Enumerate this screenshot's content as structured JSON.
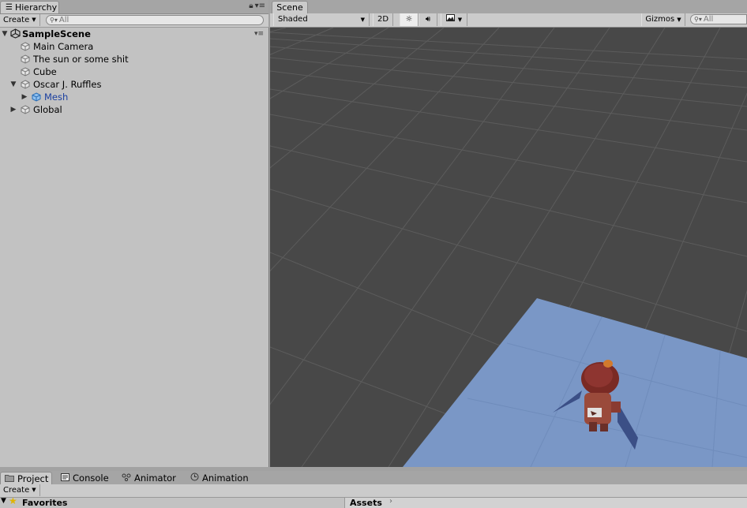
{
  "hierarchy": {
    "tab_label": "Hierarchy",
    "create_label": "Create",
    "search_placeholder": "All",
    "scene_name": "SampleScene",
    "items": [
      {
        "label": "Main Camera"
      },
      {
        "label": "The sun or some shit"
      },
      {
        "label": "Cube"
      },
      {
        "label": "Oscar J. Ruffles"
      },
      {
        "label": "Mesh"
      },
      {
        "label": "Global"
      }
    ]
  },
  "scene": {
    "tab_label": "Scene",
    "shading_mode": "Shaded",
    "mode_2d_label": "2D",
    "gizmos_label": "Gizmos",
    "search_placeholder": "All"
  },
  "bottom": {
    "tabs": [
      {
        "label": "Project"
      },
      {
        "label": "Console"
      },
      {
        "label": "Animator"
      },
      {
        "label": "Animation"
      }
    ],
    "create_label": "Create",
    "favorites_label": "Favorites",
    "assets_label": "Assets"
  },
  "colors": {
    "selected_text": "#1a3fa0",
    "plane": "#7a97c6",
    "grid_bg": "#484848"
  }
}
